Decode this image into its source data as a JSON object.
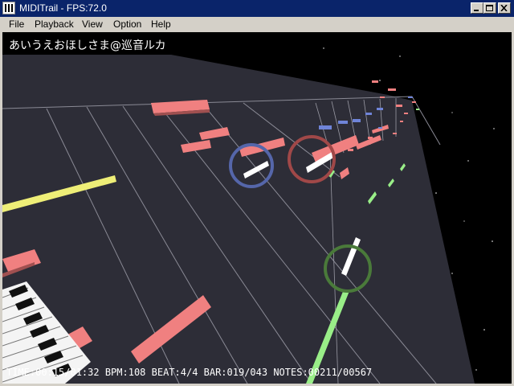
{
  "window": {
    "title": "MIDITrail - FPS:72.0",
    "icon": "miditrail-keyboard-icon"
  },
  "title_buttons": [
    "minimize-icon",
    "maximize-icon",
    "close-icon"
  ],
  "menu": [
    {
      "label": "File"
    },
    {
      "label": "Playback"
    },
    {
      "label": "View"
    },
    {
      "label": "Option"
    },
    {
      "label": "Help"
    }
  ],
  "viewer": {
    "song_title": "あいうえおほしさま@巡音ルカ",
    "status": "TIME:00:15/01:32 BPM:108 BEAT:4/4 BAR:019/043 NOTES:00211/00567",
    "colors": {
      "pink": "#f08080",
      "blue": "#6f84d8",
      "green": "#99ee88",
      "yellow": "#eeee77",
      "ring_blue": "#5566aa",
      "ring_red": "#a04848",
      "ring_green": "#4a7a3a"
    }
  }
}
